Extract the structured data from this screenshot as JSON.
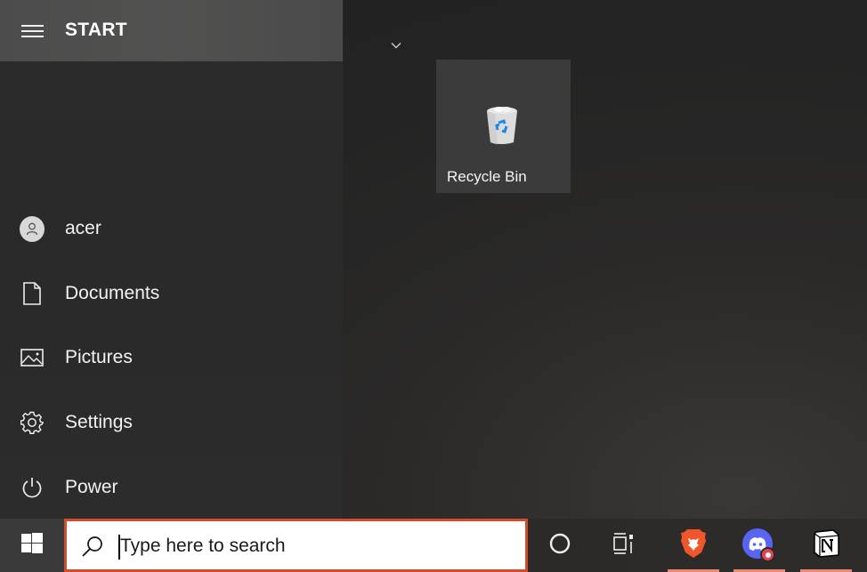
{
  "start_menu": {
    "header": {
      "title": "START",
      "menu_icon": "hamburger-icon"
    },
    "nav_items": [
      {
        "label": "acer",
        "icon": "user-avatar-icon"
      },
      {
        "label": "Documents",
        "icon": "document-icon"
      },
      {
        "label": "Pictures",
        "icon": "pictures-icon"
      },
      {
        "label": "Settings",
        "icon": "gear-icon"
      },
      {
        "label": "Power",
        "icon": "power-icon"
      }
    ],
    "tiles_group_toggle": "chevron-down-icon",
    "tiles": [
      {
        "label": "Recycle Bin",
        "icon": "recycle-bin-icon"
      }
    ]
  },
  "taskbar": {
    "start_icon": "windows-logo-icon",
    "search": {
      "placeholder": "Type here to search",
      "value": ""
    },
    "buttons": [
      {
        "name": "cortana",
        "icon": "cortana-circle-icon",
        "running": false
      },
      {
        "name": "task-view",
        "icon": "task-view-icon",
        "running": false
      },
      {
        "name": "brave",
        "icon": "brave-browser-icon",
        "running": true
      },
      {
        "name": "discord",
        "icon": "discord-icon",
        "running": true,
        "badge": true
      },
      {
        "name": "notion",
        "icon": "notion-icon",
        "running": true
      }
    ]
  },
  "colors": {
    "search_border": "#d04e2c",
    "running_indicator": "#e98a74",
    "brave": "#f1562b",
    "discord": "#5865f2",
    "discord_badge": "#e7434f"
  }
}
